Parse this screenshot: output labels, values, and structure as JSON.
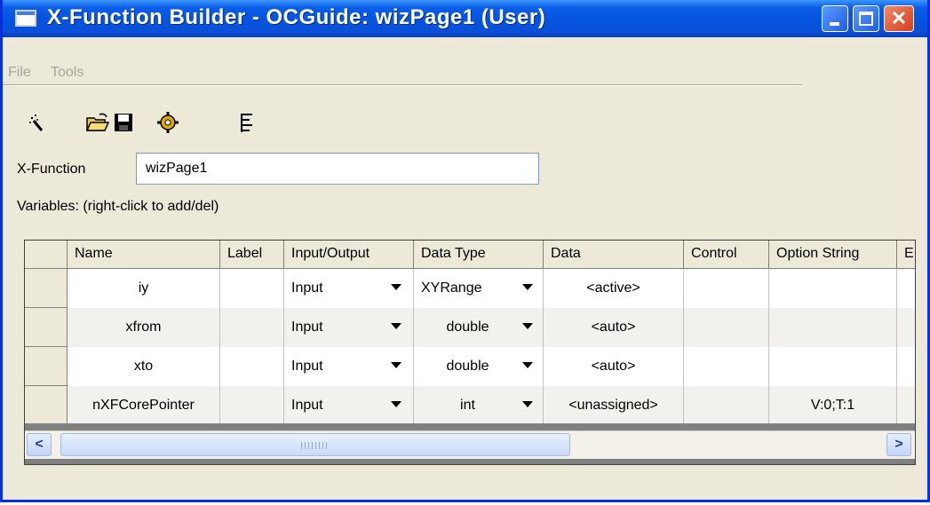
{
  "window": {
    "title": "X-Function Builder - OCGuide: wizPage1 (User)"
  },
  "menu": [
    "File",
    "Tools"
  ],
  "toolbar": {
    "icons": [
      "new-wizard-icon",
      "open-folder-icon",
      "save-icon",
      "compile-icon",
      "tree-view-icon"
    ]
  },
  "xfunction": {
    "label": "X-Function",
    "value": "wizPage1"
  },
  "variables_label": "Variables: (right-click to add/del)",
  "grid": {
    "columns": [
      "Name",
      "Label",
      "Input/Output",
      "Data Type",
      "Data",
      "Control",
      "Option String",
      "E"
    ],
    "rows": [
      {
        "name": "iy",
        "label": "",
        "io": "Input",
        "type": "XYRange",
        "data": "<active>",
        "control": "",
        "option": ""
      },
      {
        "name": "xfrom",
        "label": "",
        "io": "Input",
        "type": "double",
        "data": "<auto>",
        "control": "",
        "option": ""
      },
      {
        "name": "xto",
        "label": "",
        "io": "Input",
        "type": "double",
        "data": "<auto>",
        "control": "",
        "option": ""
      },
      {
        "name": "nXFCorePointer",
        "label": "",
        "io": "Input",
        "type": "int",
        "data": "<unassigned>",
        "control": "",
        "option": "V:0;T:1"
      }
    ]
  },
  "scrollbar": {
    "left_arrow": "<",
    "right_arrow": ">"
  },
  "colors": {
    "title_bar": "#0554e3",
    "window_bg": "#ece9d8",
    "close_button": "#d43d1a"
  }
}
